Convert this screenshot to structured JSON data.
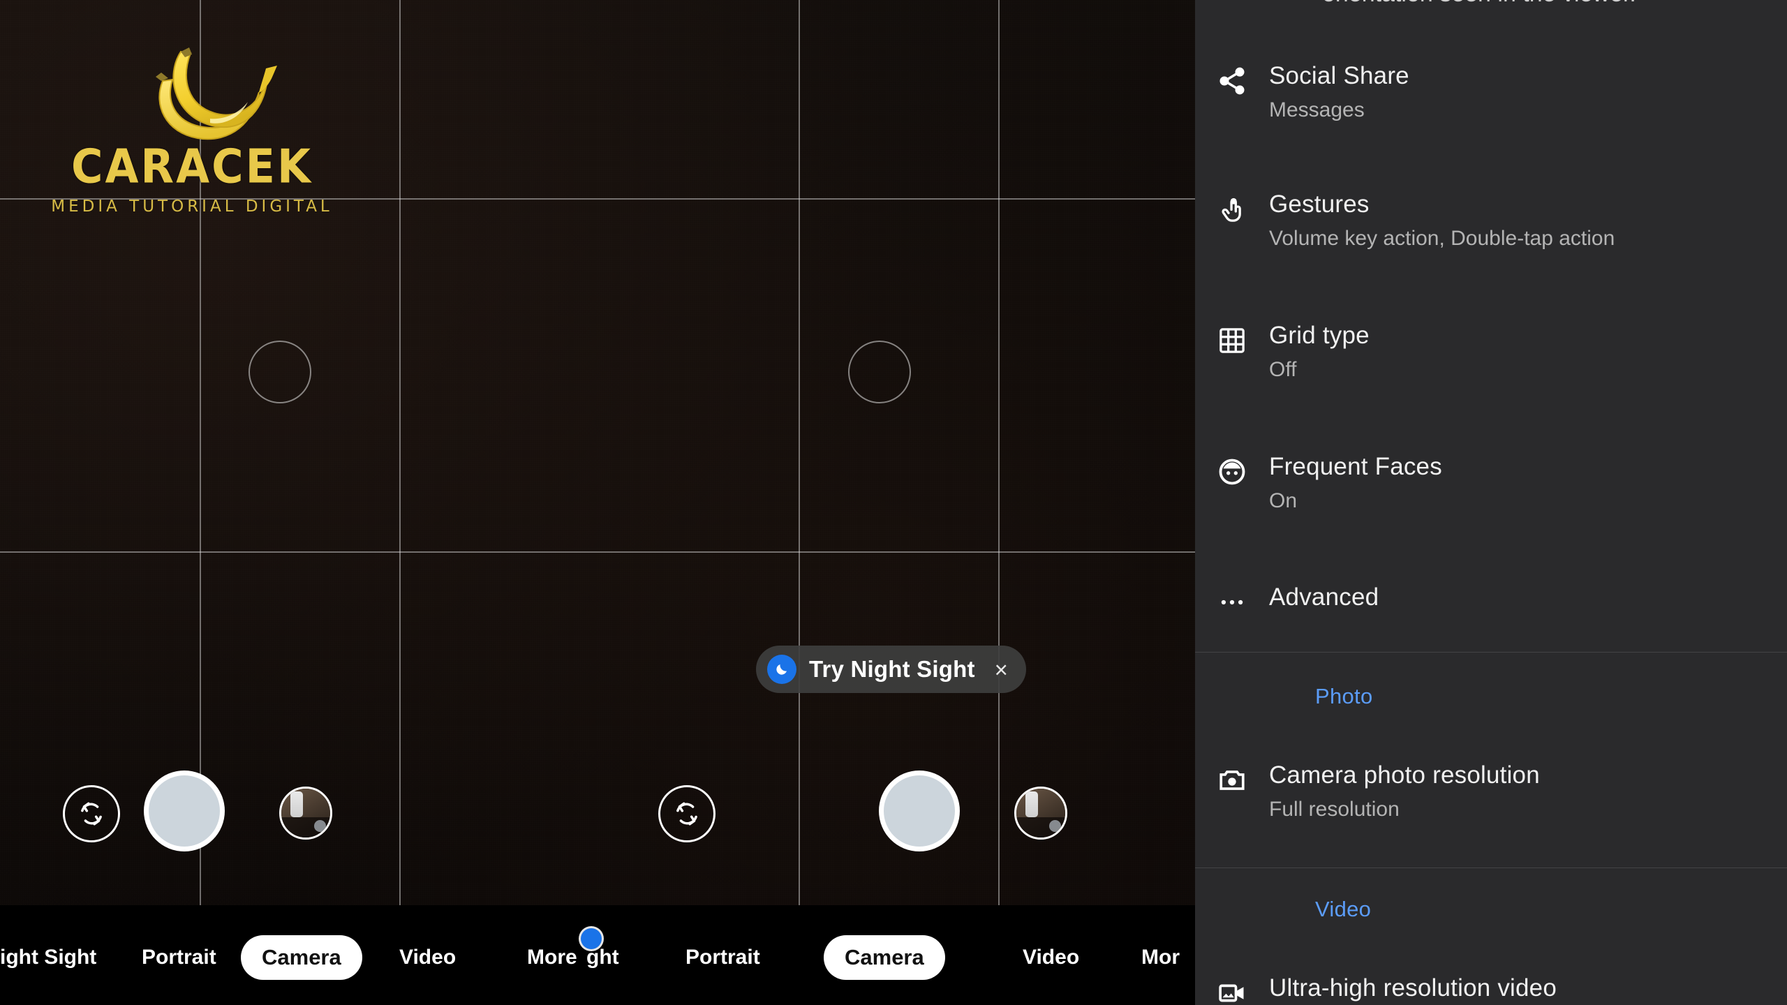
{
  "app": {
    "name": "Camera",
    "accent_blue": "#5b9cf8",
    "chip_blue": "#1a73e8",
    "panel_bg": "#2a2a2c"
  },
  "watermark": {
    "icon": "bananas-icon",
    "title": "CARACEK",
    "subtitle": "MEDIA TUTORIAL DIGITAL"
  },
  "viewfinder": {
    "night_sight_chip": {
      "icon": "moon-icon",
      "label": "Try Night Sight",
      "close": "×"
    },
    "controls": {
      "flip_camera": "flip-camera-icon",
      "shutter": "shutter-button",
      "gallery": "gallery-thumbnail"
    },
    "grid_type": "3x3"
  },
  "mode_bar_left": {
    "modes": [
      {
        "label": "ight Sight",
        "selected": false
      },
      {
        "label": "Portrait",
        "selected": false
      },
      {
        "label": "Camera",
        "selected": true
      },
      {
        "label": "Video",
        "selected": false
      },
      {
        "label": "More",
        "selected": false
      }
    ]
  },
  "mode_bar_right": {
    "modes": [
      {
        "label": "ght",
        "selected": false
      },
      {
        "label": "Portrait",
        "selected": false
      },
      {
        "label": "Camera",
        "selected": true
      },
      {
        "label": "Video",
        "selected": false
      },
      {
        "label": "Mor",
        "selected": false
      }
    ]
  },
  "settings_panel": {
    "clipped_top_text": "orientation seen in the viewer.",
    "items": [
      {
        "icon": "share-icon",
        "title": "Social Share",
        "subtitle": "Messages"
      },
      {
        "icon": "gesture-tap-icon",
        "title": "Gestures",
        "subtitle": "Volume key action, Double-tap action"
      },
      {
        "icon": "grid-icon",
        "title": "Grid type",
        "subtitle": "Off"
      },
      {
        "icon": "face-icon",
        "title": "Frequent Faces",
        "subtitle": "On"
      },
      {
        "icon": "more-horizontal-icon",
        "title": "Advanced",
        "subtitle": ""
      }
    ],
    "section_photo": {
      "header": "Photo",
      "items": [
        {
          "icon": "camera-icon",
          "title": "Camera photo resolution",
          "subtitle": "Full resolution"
        }
      ]
    },
    "section_video": {
      "header": "Video",
      "items": [
        {
          "icon": "video-camera-icon",
          "title": "Ultra-high resolution video",
          "subtitle": ""
        }
      ]
    }
  }
}
